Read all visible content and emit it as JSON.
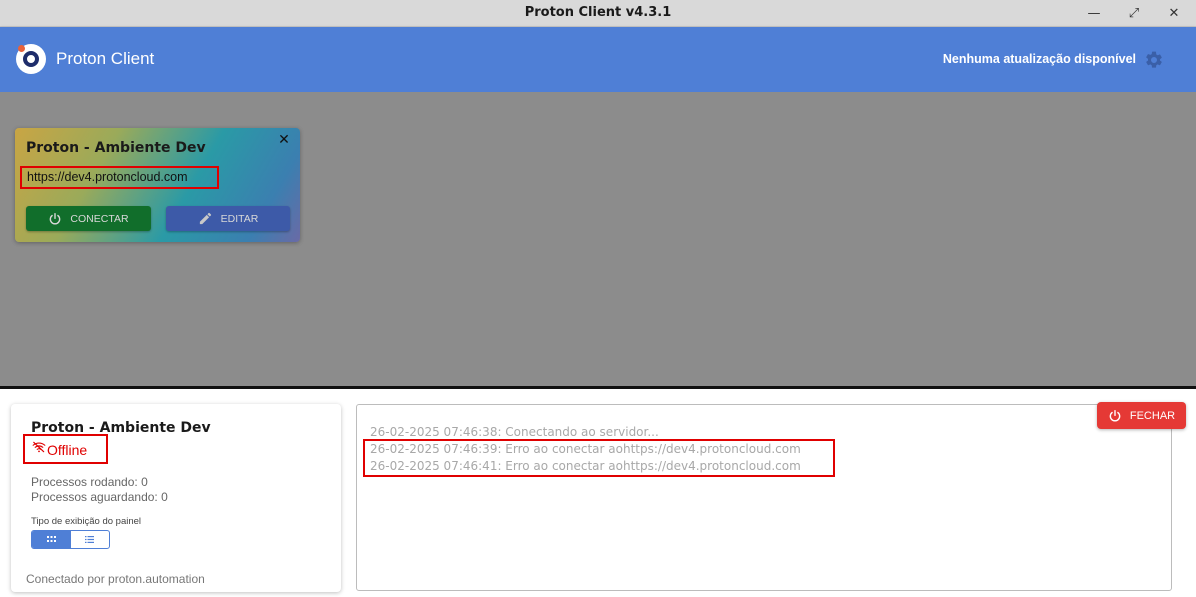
{
  "window": {
    "title": "Proton Client v4.3.1",
    "minimize_glyph": "—",
    "maximize_glyph": "⤢",
    "close_glyph": "✕"
  },
  "header": {
    "app_name": "Proton Client",
    "update_status": "Nenhuma atualização disponível",
    "settings_icon": "gear-icon"
  },
  "server_card": {
    "title": "Proton - Ambiente Dev",
    "url": "https://dev4.protoncloud.com",
    "close_glyph": "✕",
    "connect_label": "CONECTAR",
    "edit_label": "EDITAR"
  },
  "status_panel": {
    "title": "Proton - Ambiente Dev",
    "status": "Offline",
    "processes_running": "Processos rodando: 0",
    "processes_waiting": "Processos aguardando: 0",
    "view_type_label": "Tipo de exibição do painel",
    "view_options": [
      "grid",
      "list"
    ],
    "selected_view": "grid",
    "connected_by": "Conectado por proton.automation"
  },
  "log": {
    "lines": [
      "26-02-2025 07:46:38: Conectando ao servidor...",
      "26-02-2025 07:46:39: Erro ao conectar aohttps://dev4.protoncloud.com",
      "26-02-2025 07:46:41: Erro ao conectar aohttps://dev4.protoncloud.com"
    ]
  },
  "close_button": {
    "label": "FECHAR"
  },
  "colors": {
    "header_bg": "#4f7fd6",
    "overlay_bg": "#8c8c8c",
    "connect_bg": "#116e2b",
    "edit_bg": "#3d5aa8",
    "danger": "#e53935",
    "highlight": "#e00000"
  }
}
